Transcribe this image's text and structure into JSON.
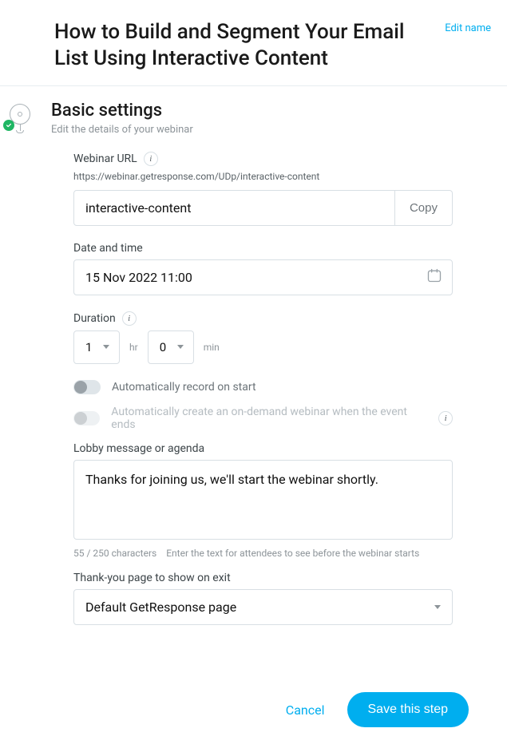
{
  "header": {
    "title": "How to Build and Segment Your Email List Using Interactive Content",
    "edit_name": "Edit name"
  },
  "section": {
    "title": "Basic settings",
    "subtitle": "Edit the details of your webinar"
  },
  "fields": {
    "webinar_url": {
      "label": "Webinar URL",
      "preview": "https://webinar.getresponse.com/UDp/interactive-content",
      "slug_value": "interactive-content",
      "copy_label": "Copy"
    },
    "datetime": {
      "label": "Date and time",
      "value": "15 Nov 2022 11:00"
    },
    "duration": {
      "label": "Duration",
      "hours": "1",
      "hr_unit": "hr",
      "minutes": "0",
      "min_unit": "min"
    },
    "toggle_autorecord": "Automatically record on start",
    "toggle_ondemand": "Automatically create an on-demand webinar when the event ends",
    "lobby": {
      "label": "Lobby message or agenda",
      "value": "Thanks for joining us, we'll start the webinar shortly.",
      "counter": "55 / 250 characters",
      "hint": "Enter the text for attendees to see before the webinar starts"
    },
    "thankyou": {
      "label": "Thank-you page to show on exit",
      "value": "Default GetResponse page"
    }
  },
  "footer": {
    "cancel": "Cancel",
    "save": "Save this step"
  }
}
